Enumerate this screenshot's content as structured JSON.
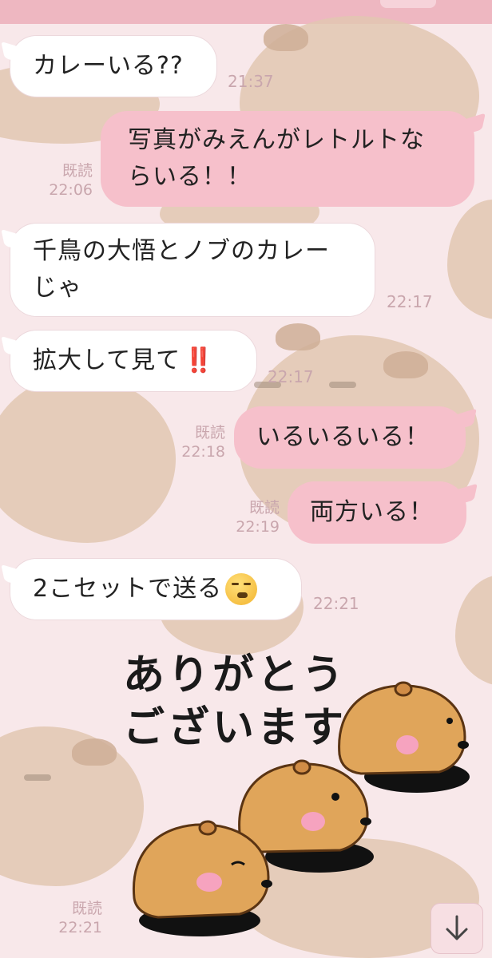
{
  "messages": [
    {
      "dir": "in",
      "text": "カレーいる??",
      "time": "21:37"
    },
    {
      "dir": "out",
      "lines": [
        "写真がみえんがレトルトな",
        "らいる！！"
      ],
      "read": "既読",
      "time": "22:06"
    },
    {
      "dir": "in",
      "lines": [
        "千鳥の大悟とノブのカレー",
        "じゃ"
      ],
      "time": "22:17"
    },
    {
      "dir": "in",
      "text": "拡大して見て",
      "emoji": "‼️",
      "time": "22:17"
    },
    {
      "dir": "out",
      "text": "いるいるいる！",
      "read": "既読",
      "time": "22:18"
    },
    {
      "dir": "out",
      "text": "両方いる！",
      "read": "既読",
      "time": "22:19"
    },
    {
      "dir": "in",
      "text": "2こセットで送る",
      "emoji": "face-with-raised-eyebrow",
      "time": "22:21"
    },
    {
      "dir": "out",
      "type": "sticker",
      "sticker_text": [
        "ありがとう",
        "ございます"
      ],
      "read": "既読",
      "time": "22:21"
    }
  ],
  "icons": {
    "scroll_down": "arrow-down-icon"
  },
  "colors": {
    "header": "#eeb7c1",
    "outgoing_bubble": "#f6c0cb",
    "incoming_bubble": "#ffffff",
    "background": "#f8e8ea",
    "meta_text": "#c9a6ad"
  }
}
